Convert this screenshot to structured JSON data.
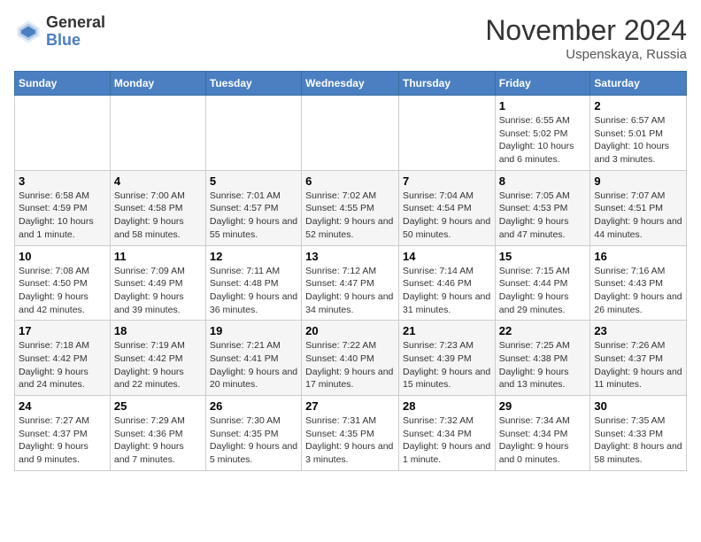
{
  "header": {
    "logo_general": "General",
    "logo_blue": "Blue",
    "month_title": "November 2024",
    "location": "Uspenskaya, Russia"
  },
  "weekdays": [
    "Sunday",
    "Monday",
    "Tuesday",
    "Wednesday",
    "Thursday",
    "Friday",
    "Saturday"
  ],
  "weeks": [
    [
      {
        "day": "",
        "info": ""
      },
      {
        "day": "",
        "info": ""
      },
      {
        "day": "",
        "info": ""
      },
      {
        "day": "",
        "info": ""
      },
      {
        "day": "",
        "info": ""
      },
      {
        "day": "1",
        "info": "Sunrise: 6:55 AM\nSunset: 5:02 PM\nDaylight: 10 hours and 6 minutes."
      },
      {
        "day": "2",
        "info": "Sunrise: 6:57 AM\nSunset: 5:01 PM\nDaylight: 10 hours and 3 minutes."
      }
    ],
    [
      {
        "day": "3",
        "info": "Sunrise: 6:58 AM\nSunset: 4:59 PM\nDaylight: 10 hours and 1 minute."
      },
      {
        "day": "4",
        "info": "Sunrise: 7:00 AM\nSunset: 4:58 PM\nDaylight: 9 hours and 58 minutes."
      },
      {
        "day": "5",
        "info": "Sunrise: 7:01 AM\nSunset: 4:57 PM\nDaylight: 9 hours and 55 minutes."
      },
      {
        "day": "6",
        "info": "Sunrise: 7:02 AM\nSunset: 4:55 PM\nDaylight: 9 hours and 52 minutes."
      },
      {
        "day": "7",
        "info": "Sunrise: 7:04 AM\nSunset: 4:54 PM\nDaylight: 9 hours and 50 minutes."
      },
      {
        "day": "8",
        "info": "Sunrise: 7:05 AM\nSunset: 4:53 PM\nDaylight: 9 hours and 47 minutes."
      },
      {
        "day": "9",
        "info": "Sunrise: 7:07 AM\nSunset: 4:51 PM\nDaylight: 9 hours and 44 minutes."
      }
    ],
    [
      {
        "day": "10",
        "info": "Sunrise: 7:08 AM\nSunset: 4:50 PM\nDaylight: 9 hours and 42 minutes."
      },
      {
        "day": "11",
        "info": "Sunrise: 7:09 AM\nSunset: 4:49 PM\nDaylight: 9 hours and 39 minutes."
      },
      {
        "day": "12",
        "info": "Sunrise: 7:11 AM\nSunset: 4:48 PM\nDaylight: 9 hours and 36 minutes."
      },
      {
        "day": "13",
        "info": "Sunrise: 7:12 AM\nSunset: 4:47 PM\nDaylight: 9 hours and 34 minutes."
      },
      {
        "day": "14",
        "info": "Sunrise: 7:14 AM\nSunset: 4:46 PM\nDaylight: 9 hours and 31 minutes."
      },
      {
        "day": "15",
        "info": "Sunrise: 7:15 AM\nSunset: 4:44 PM\nDaylight: 9 hours and 29 minutes."
      },
      {
        "day": "16",
        "info": "Sunrise: 7:16 AM\nSunset: 4:43 PM\nDaylight: 9 hours and 26 minutes."
      }
    ],
    [
      {
        "day": "17",
        "info": "Sunrise: 7:18 AM\nSunset: 4:42 PM\nDaylight: 9 hours and 24 minutes."
      },
      {
        "day": "18",
        "info": "Sunrise: 7:19 AM\nSunset: 4:42 PM\nDaylight: 9 hours and 22 minutes."
      },
      {
        "day": "19",
        "info": "Sunrise: 7:21 AM\nSunset: 4:41 PM\nDaylight: 9 hours and 20 minutes."
      },
      {
        "day": "20",
        "info": "Sunrise: 7:22 AM\nSunset: 4:40 PM\nDaylight: 9 hours and 17 minutes."
      },
      {
        "day": "21",
        "info": "Sunrise: 7:23 AM\nSunset: 4:39 PM\nDaylight: 9 hours and 15 minutes."
      },
      {
        "day": "22",
        "info": "Sunrise: 7:25 AM\nSunset: 4:38 PM\nDaylight: 9 hours and 13 minutes."
      },
      {
        "day": "23",
        "info": "Sunrise: 7:26 AM\nSunset: 4:37 PM\nDaylight: 9 hours and 11 minutes."
      }
    ],
    [
      {
        "day": "24",
        "info": "Sunrise: 7:27 AM\nSunset: 4:37 PM\nDaylight: 9 hours and 9 minutes."
      },
      {
        "day": "25",
        "info": "Sunrise: 7:29 AM\nSunset: 4:36 PM\nDaylight: 9 hours and 7 minutes."
      },
      {
        "day": "26",
        "info": "Sunrise: 7:30 AM\nSunset: 4:35 PM\nDaylight: 9 hours and 5 minutes."
      },
      {
        "day": "27",
        "info": "Sunrise: 7:31 AM\nSunset: 4:35 PM\nDaylight: 9 hours and 3 minutes."
      },
      {
        "day": "28",
        "info": "Sunrise: 7:32 AM\nSunset: 4:34 PM\nDaylight: 9 hours and 1 minute."
      },
      {
        "day": "29",
        "info": "Sunrise: 7:34 AM\nSunset: 4:34 PM\nDaylight: 9 hours and 0 minutes."
      },
      {
        "day": "30",
        "info": "Sunrise: 7:35 AM\nSunset: 4:33 PM\nDaylight: 8 hours and 58 minutes."
      }
    ]
  ]
}
